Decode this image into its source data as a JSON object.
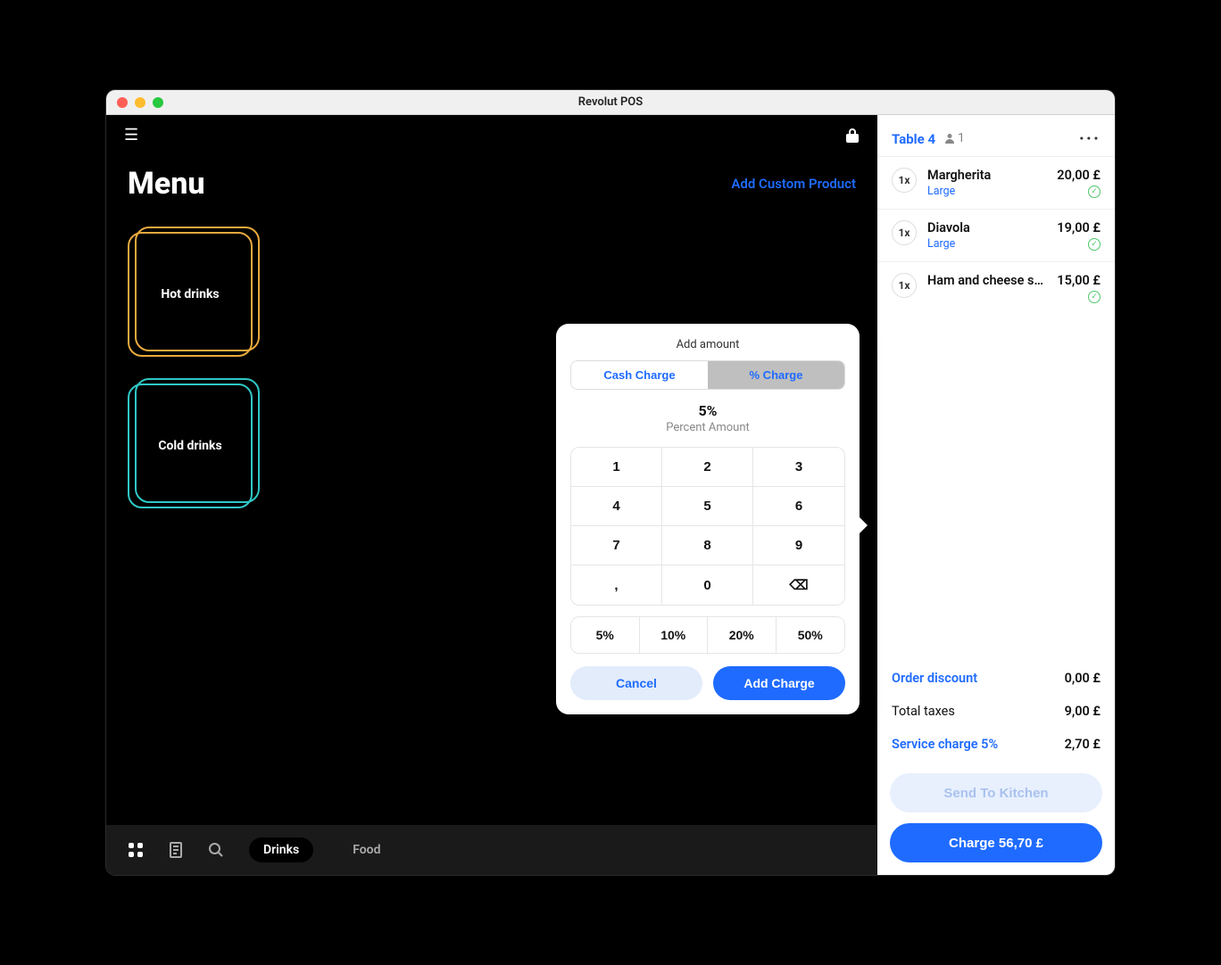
{
  "window": {
    "title": "Revolut POS"
  },
  "header": {
    "title": "Menu",
    "add_custom": "Add Custom Product"
  },
  "categories": [
    {
      "label": "Hot drinks",
      "style": "hot"
    },
    {
      "label": "Cold drinks",
      "style": "cold"
    }
  ],
  "bottombar": {
    "tabs": [
      {
        "label": "Drinks",
        "active": true
      },
      {
        "label": "Food",
        "active": false
      }
    ]
  },
  "order": {
    "table": "Table 4",
    "party": "1",
    "items": [
      {
        "qty": "1x",
        "name": "Margherita",
        "variant": "Large",
        "price": "20,00 £",
        "confirmed": true
      },
      {
        "qty": "1x",
        "name": "Diavola",
        "variant": "Large",
        "price": "19,00 £",
        "confirmed": true
      },
      {
        "qty": "1x",
        "name": "Ham and cheese sa…",
        "variant": "",
        "price": "15,00 £",
        "confirmed": true
      }
    ],
    "summary": {
      "discount_label": "Order discount",
      "discount_value": "0,00 £",
      "taxes_label": "Total taxes",
      "taxes_value": "9,00 £",
      "service_label": "Service charge 5%",
      "service_value": "2,70 £"
    },
    "actions": {
      "kitchen": "Send To Kitchen",
      "charge": "Charge 56,70 £"
    }
  },
  "popover": {
    "title": "Add amount",
    "tabs": {
      "cash": "Cash Charge",
      "pct": "% Charge"
    },
    "amount": "5%",
    "amount_label": "Percent Amount",
    "keys": [
      "1",
      "2",
      "3",
      "4",
      "5",
      "6",
      "7",
      "8",
      "9",
      ",",
      "0",
      "⌫"
    ],
    "presets": [
      "5%",
      "10%",
      "20%",
      "50%"
    ],
    "cancel": "Cancel",
    "add": "Add Charge"
  }
}
